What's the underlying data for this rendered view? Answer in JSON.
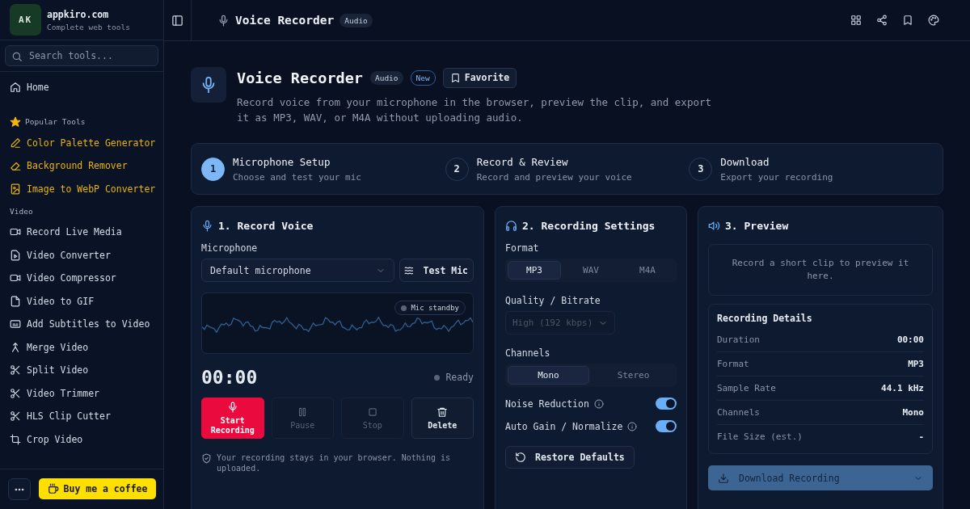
{
  "sidebar": {
    "brand": {
      "initials": "AK",
      "name": "appkiro.com",
      "tagline": "Complete web tools"
    },
    "search": {
      "placeholder": "Search tools..."
    },
    "home": {
      "label": "Home"
    },
    "sections": [
      {
        "title": "Popular Tools",
        "kind": "popular",
        "items": [
          {
            "label": "Color Palette Generator"
          },
          {
            "label": "Background Remover"
          },
          {
            "label": "Image to WebP Converter"
          }
        ]
      },
      {
        "title": "Video",
        "kind": "category",
        "items": [
          {
            "label": "Record Live Media"
          },
          {
            "label": "Video Converter"
          },
          {
            "label": "Video Compressor"
          },
          {
            "label": "Video to GIF"
          },
          {
            "label": "Add Subtitles to Video"
          },
          {
            "label": "Merge Video"
          },
          {
            "label": "Split Video"
          },
          {
            "label": "Video Trimmer"
          },
          {
            "label": "HLS Clip Cutter"
          },
          {
            "label": "Crop Video"
          }
        ]
      }
    ],
    "coffee_button": "Buy me a coffee"
  },
  "header": {
    "title": "Voice Recorder",
    "badge": "Audio"
  },
  "hero": {
    "title": "Voice Recorder",
    "badges": [
      {
        "label": "Audio",
        "kind": "category"
      },
      {
        "label": "New",
        "kind": "new"
      }
    ],
    "favorite_button": "Favorite",
    "description": "Record voice from your microphone in the browser, preview the clip, and export it as MP3, WAV, or M4A without uploading audio."
  },
  "steps": [
    {
      "number": "1",
      "title": "Microphone Setup",
      "subtitle": "Choose and test your mic",
      "selected": true
    },
    {
      "number": "2",
      "title": "Record & Review",
      "subtitle": "Record and preview your voice",
      "selected": false
    },
    {
      "number": "3",
      "title": "Download",
      "subtitle": "Export your recording",
      "selected": false
    }
  ],
  "record_panel": {
    "title": "1. Record Voice",
    "microphone_label": "Microphone",
    "microphone_select": "Default microphone",
    "test_button": "Test Mic",
    "visualizer_badge": "Mic standby",
    "timer": "00:00",
    "status": "Ready",
    "buttons": [
      {
        "label": "Start Recording",
        "kind": "primary",
        "disabled": false
      },
      {
        "label": "Pause",
        "kind": "secondary",
        "disabled": true
      },
      {
        "label": "Stop",
        "kind": "secondary",
        "disabled": true
      },
      {
        "label": "Delete",
        "kind": "secondary",
        "disabled": false
      }
    ],
    "note": "Your recording stays in your browser. Nothing is uploaded."
  },
  "settings_panel": {
    "title": "2. Recording Settings",
    "format_label": "Format",
    "formats": [
      {
        "label": "MP3",
        "selected": true
      },
      {
        "label": "WAV",
        "selected": false
      },
      {
        "label": "M4A",
        "selected": false
      }
    ],
    "quality_label": "Quality / Bitrate",
    "quality_select": {
      "value": "High (192 kbps)",
      "disabled": true
    },
    "channels_label": "Channels",
    "channels": [
      {
        "label": "Mono",
        "selected": true
      },
      {
        "label": "Stereo",
        "selected": false
      }
    ],
    "toggles": [
      {
        "label": "Noise Reduction",
        "on": true
      },
      {
        "label": "Auto Gain / Normalize",
        "on": true
      }
    ],
    "restore_button": "Restore Defaults"
  },
  "preview_panel": {
    "title": "3. Preview",
    "empty_message": "Record a short clip to preview it here.",
    "details_title": "Recording Details",
    "details": [
      {
        "label": "Duration",
        "value": "00:00"
      },
      {
        "label": "Format",
        "value": "MP3"
      },
      {
        "label": "Sample Rate",
        "value": "44.1 kHz"
      },
      {
        "label": "Channels",
        "value": "Mono"
      },
      {
        "label": "File Size (est.)",
        "value": "-"
      }
    ],
    "download_button": {
      "label": "Download Recording",
      "disabled": true
    }
  }
}
